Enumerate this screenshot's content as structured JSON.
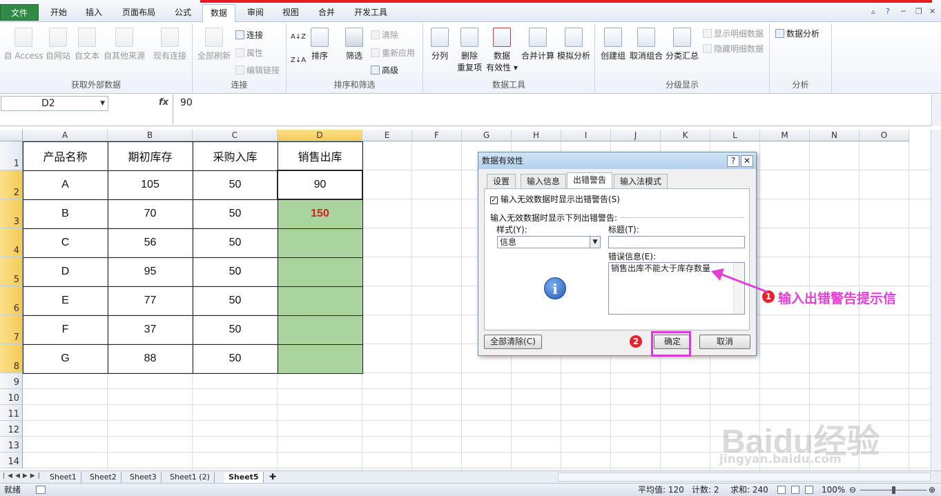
{
  "ribbon_tabs": [
    "文件",
    "开始",
    "插入",
    "页面布局",
    "公式",
    "数据",
    "审阅",
    "视图",
    "合并",
    "开发工具"
  ],
  "active_tab": "数据",
  "ribbon": {
    "get_external": {
      "label": "获取外部数据",
      "access": "自 Access",
      "web": "自网站",
      "text": "自文本",
      "other": "自其他来源",
      "existing": "现有连接"
    },
    "connections": {
      "label": "连接",
      "refresh_all": "全部刷新",
      "connections": "连接",
      "properties": "属性",
      "edit_links": "编辑链接"
    },
    "sort_filter": {
      "label": "排序和筛选",
      "sort": "排序",
      "filter": "筛选",
      "clear": "清除",
      "reapply": "重新应用",
      "advanced": "高级"
    },
    "data_tools": {
      "label": "数据工具",
      "split": "分列",
      "remove_dup_1": "删除",
      "remove_dup_2": "重复项",
      "validation_1": "数据",
      "validation_2": "有效性",
      "consolidate": "合并计算",
      "whatif": "模拟分析"
    },
    "outline": {
      "label": "分级显示",
      "group": "创建组",
      "ungroup": "取消组合",
      "subtotal": "分类汇总",
      "show_detail": "显示明细数据",
      "hide_detail": "隐藏明细数据"
    },
    "analysis": {
      "label": "分析",
      "data_analysis": "数据分析"
    }
  },
  "formula_bar": {
    "name_box": "D2",
    "fx": "fx",
    "value": "90"
  },
  "columns": [
    "A",
    "B",
    "C",
    "D",
    "E",
    "F",
    "G",
    "H",
    "I",
    "J",
    "K",
    "L",
    "M",
    "N",
    "O"
  ],
  "rows": [
    "1",
    "2",
    "3",
    "4",
    "5",
    "6",
    "7",
    "8",
    "9",
    "10",
    "11",
    "12",
    "13",
    "14"
  ],
  "table": {
    "headers": [
      "产品名称",
      "期初库存",
      "采购入库",
      "销售出库"
    ],
    "rows": [
      [
        "A",
        "105",
        "50",
        "90"
      ],
      [
        "B",
        "70",
        "50",
        "150"
      ],
      [
        "C",
        "56",
        "50",
        ""
      ],
      [
        "D",
        "95",
        "50",
        ""
      ],
      [
        "E",
        "77",
        "50",
        ""
      ],
      [
        "F",
        "37",
        "50",
        ""
      ],
      [
        "G",
        "88",
        "50",
        ""
      ]
    ]
  },
  "dialog": {
    "title": "数据有效性",
    "help": "?",
    "close": "✕",
    "tabs": [
      "设置",
      "输入信息",
      "出错警告",
      "输入法模式"
    ],
    "active_tab": "出错警告",
    "show_error_check": "输入无效数据时显示出错警告(S)",
    "section_label": "输入无效数据时显示下列出错警告:",
    "style_label": "样式(Y):",
    "style_value": "信息",
    "title_label": "标题(T):",
    "title_value": "",
    "error_msg_label": "错误信息(E):",
    "error_msg_value": "销售出库不能大于库存数量",
    "clear_all": "全部清除(C)",
    "ok": "确定",
    "cancel": "取消"
  },
  "annotations": {
    "callout_text": "输入出错警告提示信",
    "badge1": "1",
    "badge2": "2",
    "callout_color": "#e23fd6"
  },
  "sheet_tabs": [
    "Sheet1",
    "Sheet2",
    "Sheet3",
    "Sheet1 (2)",
    "Sheet5"
  ],
  "active_sheet": "Sheet5",
  "status": {
    "ready": "就绪",
    "average": "平均值: 120",
    "count": "计数: 2",
    "sum": "求和: 240",
    "zoom": "100%"
  },
  "watermark": {
    "logo": "Baidu经验",
    "url": "jingyan.baidu.com"
  }
}
